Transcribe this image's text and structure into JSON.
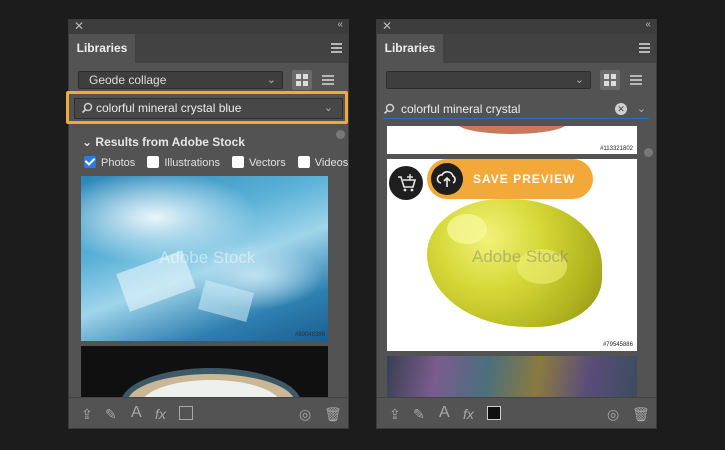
{
  "left_panel": {
    "title": "Libraries",
    "library_select": "Geode collage",
    "search_value": "colorful mineral crystal blue",
    "results_header": "Results from Adobe Stock",
    "filters": [
      {
        "label": "Photos",
        "checked": true
      },
      {
        "label": "Illustrations",
        "checked": false
      },
      {
        "label": "Vectors",
        "checked": false
      },
      {
        "label": "Videos",
        "checked": false
      }
    ],
    "images": [
      {
        "watermark": "Adobe Stock",
        "id": "#89048388"
      }
    ]
  },
  "right_panel": {
    "title": "Libraries",
    "library_select": "",
    "search_value": "colorful mineral crystal",
    "save_preview_label": "SAVE PREVIEW",
    "images": [
      {
        "id": "#113321802"
      },
      {
        "watermark": "Adobe Stock",
        "id": "#79545886"
      }
    ]
  },
  "colors": {
    "panel_bg": "#535353",
    "highlight": "#f2a93a",
    "checkbox_on": "#2d7be0",
    "save_pill": "#f2a93a"
  },
  "icons": [
    "close-icon",
    "collapse-icon",
    "panel-menu-icon",
    "chevron-down-icon",
    "grid-view-icon",
    "list-view-icon",
    "search-icon",
    "clear-icon",
    "upload-icon",
    "brush-icon",
    "text-icon",
    "fx-icon",
    "color-swatch-icon",
    "creative-cloud-icon",
    "trash-icon",
    "add-to-cart-icon",
    "cloud-upload-icon"
  ]
}
